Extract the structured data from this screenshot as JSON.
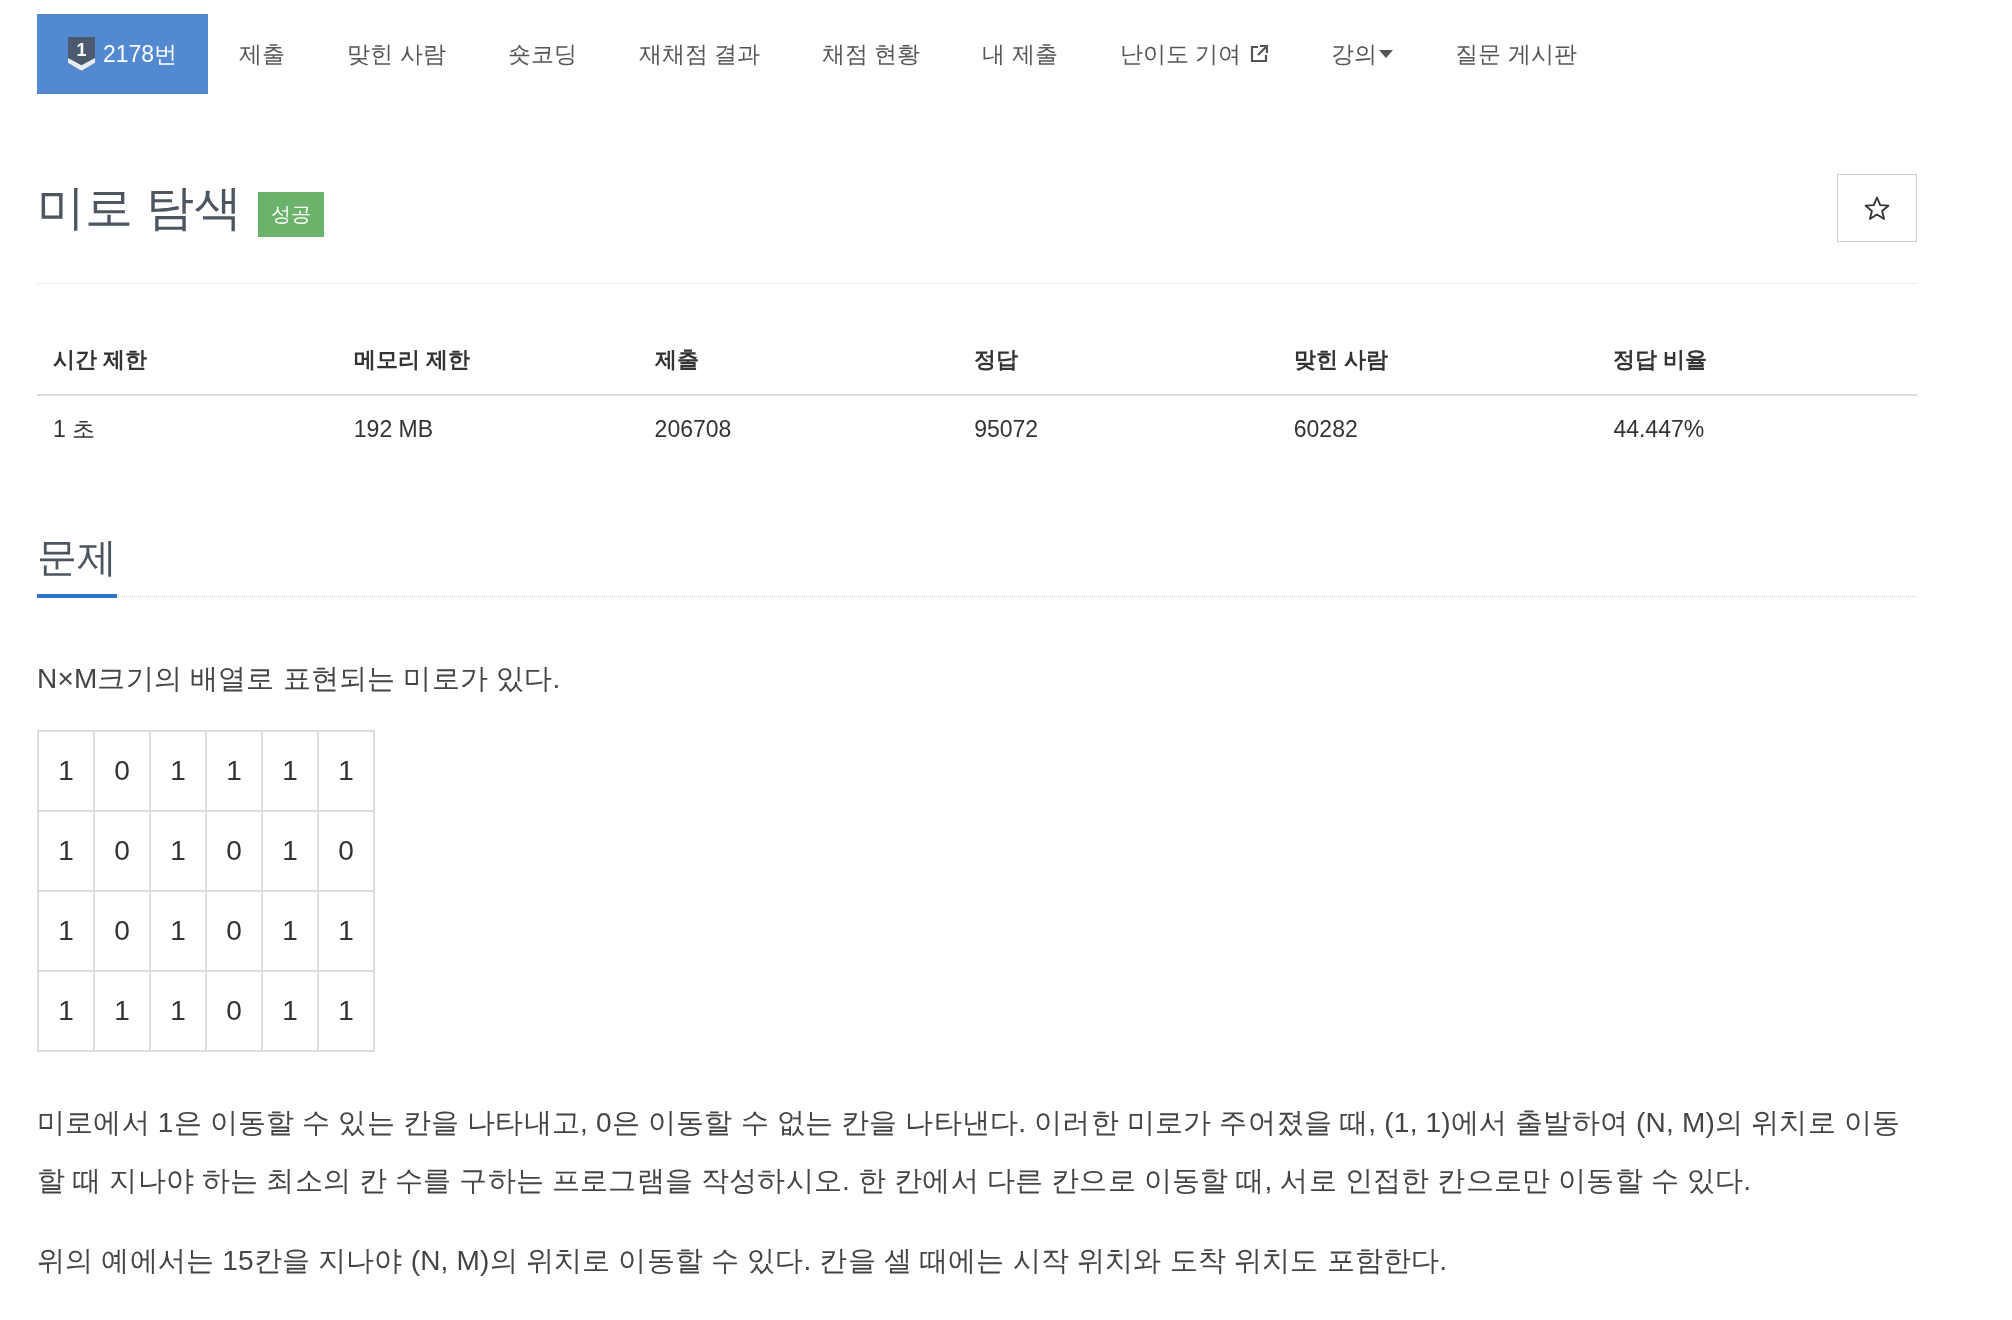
{
  "nav": {
    "tabs": [
      {
        "label": "2178번",
        "badge": "1",
        "kind": "link",
        "selected": true
      },
      {
        "label": "제출",
        "kind": "link",
        "selected": false
      },
      {
        "label": "맞힌 사람",
        "kind": "link",
        "selected": false
      },
      {
        "label": "숏코딩",
        "kind": "link",
        "selected": false
      },
      {
        "label": "재채점 결과",
        "kind": "link",
        "selected": false
      },
      {
        "label": "채점 현황",
        "kind": "link",
        "selected": false
      },
      {
        "label": "내 제출",
        "kind": "link",
        "selected": false
      },
      {
        "label": "난이도 기여",
        "kind": "external",
        "selected": false
      },
      {
        "label": "강의",
        "kind": "menu",
        "selected": false
      },
      {
        "label": "질문 게시판",
        "kind": "link",
        "selected": false
      }
    ]
  },
  "problem": {
    "title": "미로 탐색",
    "status": "성공",
    "starred": false
  },
  "info_table": {
    "columns": [
      "시간 제한",
      "메모리 제한",
      "제출",
      "정답",
      "맞힌 사람",
      "정답 비율"
    ],
    "rows": [
      [
        "1 초",
        "192 MB",
        "206708",
        "95072",
        "60282",
        "44.447%"
      ]
    ]
  },
  "section": {
    "title": "문제",
    "blocks": [
      {
        "kind": "text",
        "text": "N×M크기의 배열로 표현되는 미로가 있다."
      },
      {
        "kind": "grid",
        "rows": [
          [
            "1",
            "0",
            "1",
            "1",
            "1",
            "1"
          ],
          [
            "1",
            "0",
            "1",
            "0",
            "1",
            "0"
          ],
          [
            "1",
            "0",
            "1",
            "0",
            "1",
            "1"
          ],
          [
            "1",
            "1",
            "1",
            "0",
            "1",
            "1"
          ]
        ]
      },
      {
        "kind": "text",
        "text": "미로에서 1은 이동할 수 있는 칸을 나타내고, 0은 이동할 수 없는 칸을 나타낸다. 이러한 미로가 주어졌을 때, (1, 1)에서 출발하여 (N, M)의 위치로 이동할 때 지나야 하는 최소의 칸 수를 구하는 프로그램을 작성하시오. 한 칸에서 다른 칸으로 이동할 때, 서로 인접한 칸으로만 이동할 수 있다."
      },
      {
        "kind": "text",
        "text": "위의 예에서는 15칸을 지나야 (N, M)의 위치로 이동할 수 있다. 칸을 셀 때에는 시작 위치와 도착 위치도 포함한다."
      }
    ]
  }
}
